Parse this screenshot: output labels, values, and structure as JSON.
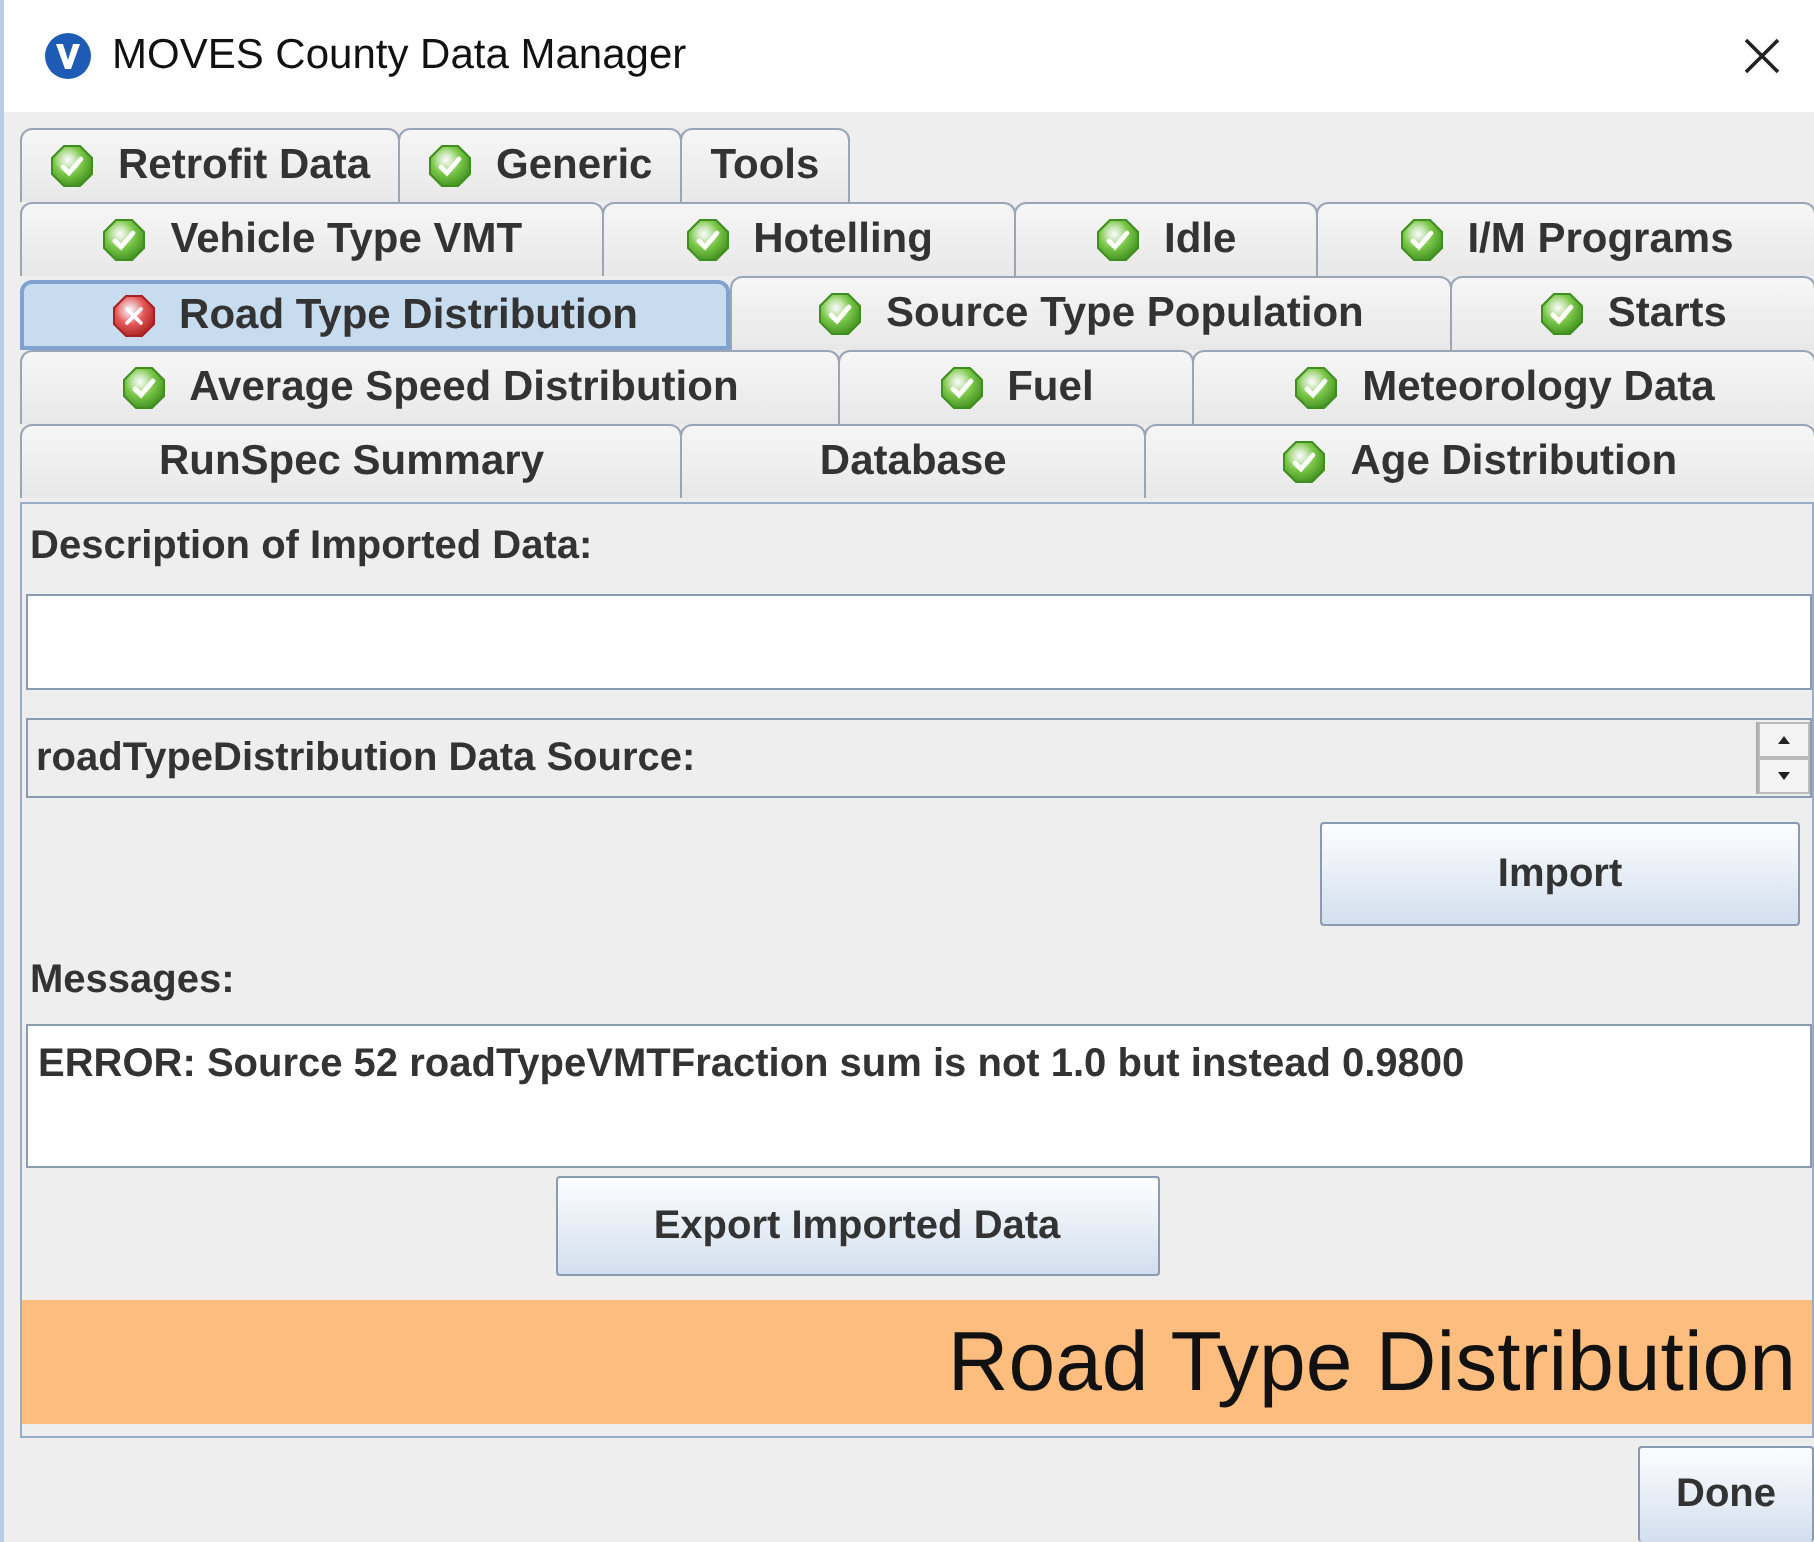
{
  "window": {
    "title": "MOVES County Data Manager"
  },
  "tab_rows": [
    [
      {
        "label": "Retrofit Data",
        "kind": "ok",
        "selected": false
      },
      {
        "label": "Generic",
        "kind": "ok",
        "selected": false
      },
      {
        "label": "Tools",
        "kind": "plain",
        "selected": false
      }
    ],
    [
      {
        "label": "Vehicle Type VMT",
        "kind": "ok",
        "selected": false
      },
      {
        "label": "Hotelling",
        "kind": "ok",
        "selected": false
      },
      {
        "label": "Idle",
        "kind": "ok",
        "selected": false
      },
      {
        "label": "I/M Programs",
        "kind": "ok",
        "selected": false
      }
    ],
    [
      {
        "label": "Road Type Distribution",
        "kind": "error",
        "selected": true
      },
      {
        "label": "Source Type Population",
        "kind": "ok",
        "selected": false
      },
      {
        "label": "Starts",
        "kind": "ok",
        "selected": false
      }
    ],
    [
      {
        "label": "Average Speed Distribution",
        "kind": "ok",
        "selected": false
      },
      {
        "label": "Fuel",
        "kind": "ok",
        "selected": false
      },
      {
        "label": "Meteorology Data",
        "kind": "ok",
        "selected": false
      }
    ],
    [
      {
        "label": "RunSpec Summary",
        "kind": "plain",
        "selected": false
      },
      {
        "label": "Database",
        "kind": "plain",
        "selected": false
      },
      {
        "label": "Age Distribution",
        "kind": "ok",
        "selected": false
      }
    ]
  ],
  "description": {
    "label": "Description of Imported Data:"
  },
  "data_source": {
    "label": "roadTypeDistribution Data Source:"
  },
  "import_button": "Import",
  "messages": {
    "label": "Messages:",
    "text": "ERROR: Source 52 roadTypeVMTFraction sum is not 1.0 but instead 0.9800"
  },
  "export_button": "Export Imported Data",
  "banner": "Road Type Distribution",
  "done_button": "Done"
}
